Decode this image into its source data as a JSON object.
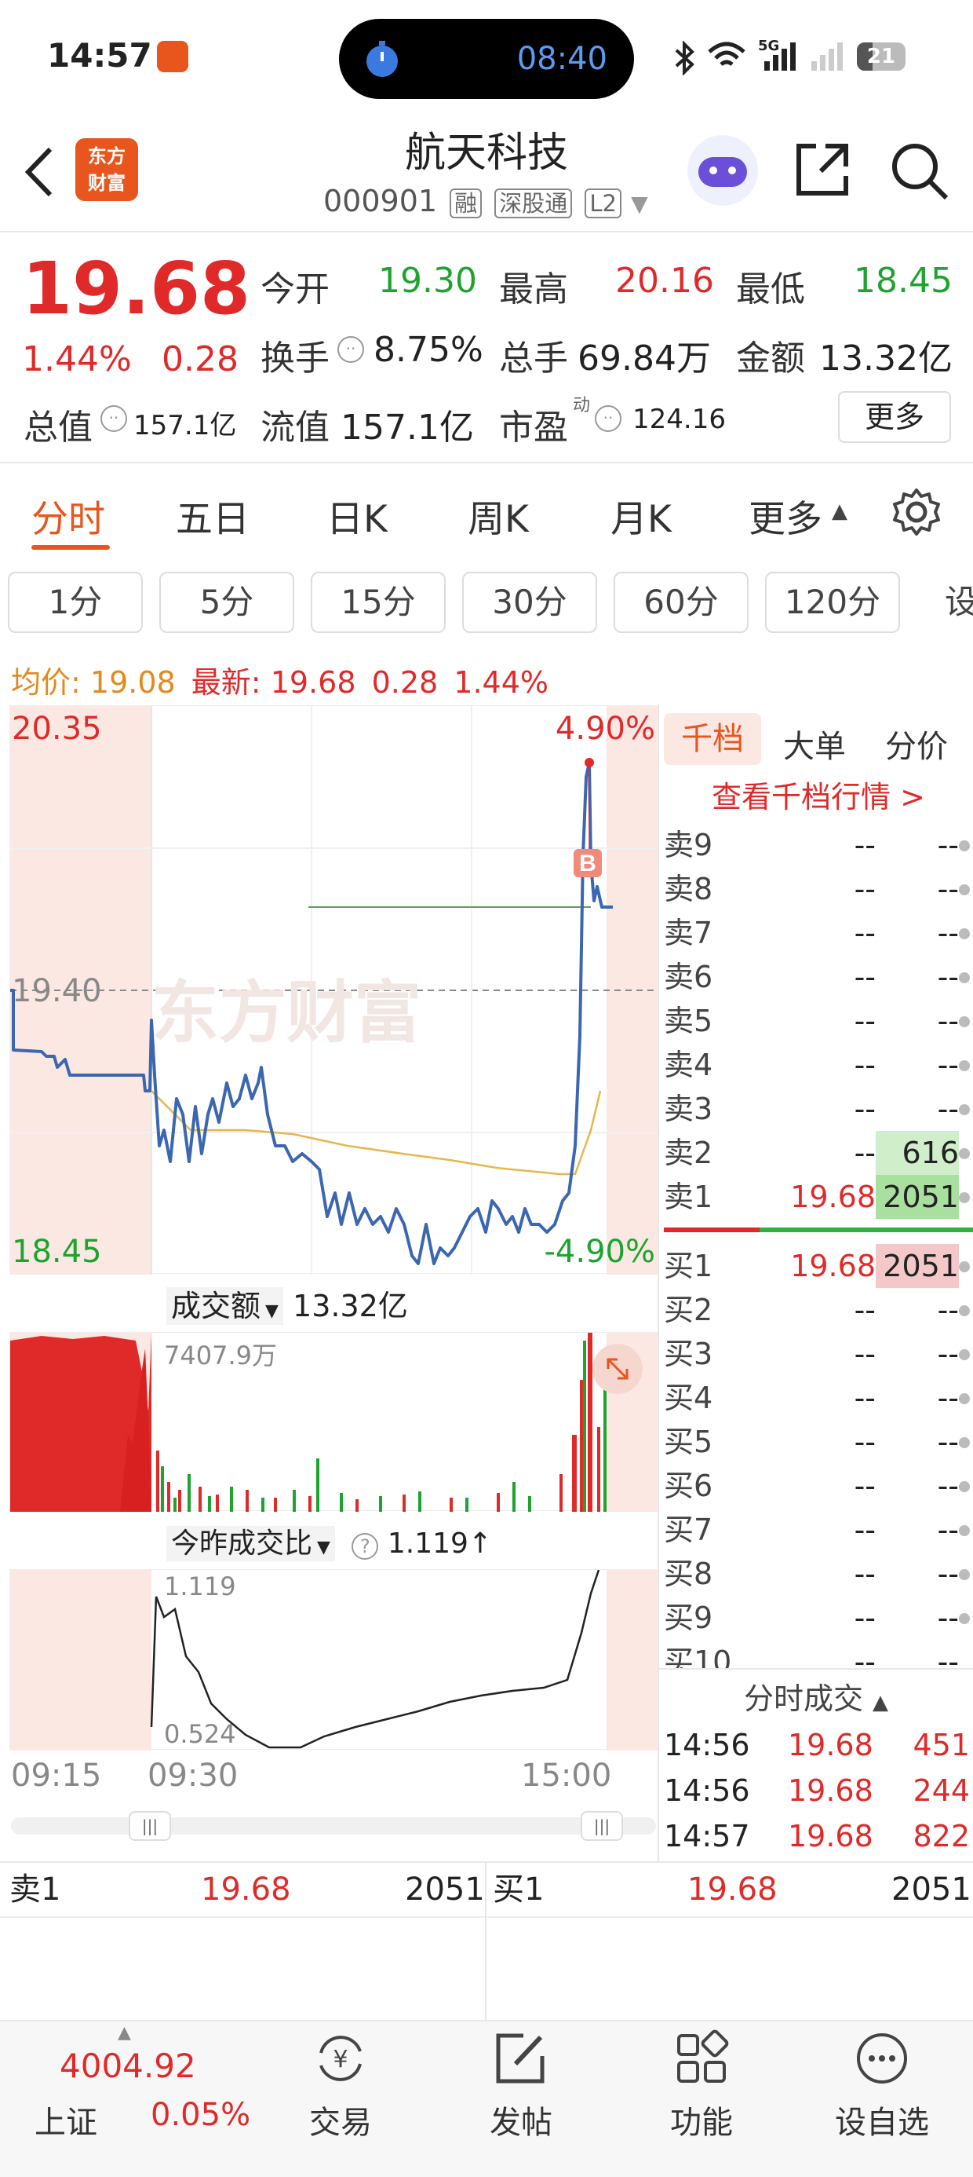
{
  "status_bar": {
    "time": "14:57",
    "timer": "08:40",
    "battery": "21",
    "network": "5G"
  },
  "header": {
    "logo_text_1": "东方",
    "logo_text_2": "财富",
    "stock_name": "航天科技",
    "stock_code": "000901",
    "tags": [
      "融",
      "深股通",
      "L2"
    ]
  },
  "quote": {
    "price": "19.68",
    "change_pct": "1.44%",
    "change": "0.28",
    "fields": {
      "open_label": "今开",
      "open": "19.30",
      "high_label": "最高",
      "high": "20.16",
      "low_label": "最低",
      "low": "18.45",
      "turnover_label": "换手",
      "turnover": "8.75%",
      "volume_label": "总手",
      "volume": "69.84万",
      "amount_label": "金额",
      "amount": "13.32亿",
      "mktcap_label": "总值",
      "mktcap": "157.1亿",
      "float_label": "流值",
      "float": "157.1亿",
      "pe_label": "市盈",
      "pe_sup": "动",
      "pe": "124.16"
    },
    "more_button": "更多"
  },
  "chart_tabs": [
    "分时",
    "五日",
    "日K",
    "周K",
    "月K",
    "更多"
  ],
  "interval_tabs": [
    "1分",
    "5分",
    "15分",
    "30分",
    "60分",
    "120分",
    "设"
  ],
  "info_line": {
    "avg_label": "均价:",
    "avg": "19.08",
    "latest_label": "最新:",
    "latest": "19.68",
    "change": "0.28",
    "change_pct": "1.44%"
  },
  "price_chart": {
    "y_top": "20.35",
    "y_mid": "19.40",
    "y_bottom": "18.45",
    "pct_top": "4.90%",
    "pct_bottom": "-4.90%",
    "watermark": "东方财富",
    "marker": "B"
  },
  "volume_panel": {
    "label": "成交额",
    "total": "13.32亿",
    "max_label": "7407.9万"
  },
  "ratio_panel": {
    "label": "今昨成交比",
    "value": "1.119",
    "arrow": "↑",
    "max_label": "1.119",
    "min_label": "0.524"
  },
  "time_axis": [
    "09:15",
    "09:30",
    "15:00"
  ],
  "order_book": {
    "tabs": [
      "千档",
      "大单",
      "分价"
    ],
    "link": "查看千档行情 >",
    "asks": [
      {
        "label": "卖9",
        "price": "--",
        "vol": "--"
      },
      {
        "label": "卖8",
        "price": "--",
        "vol": "--"
      },
      {
        "label": "卖7",
        "price": "--",
        "vol": "--"
      },
      {
        "label": "卖6",
        "price": "--",
        "vol": "--"
      },
      {
        "label": "卖5",
        "price": "--",
        "vol": "--"
      },
      {
        "label": "卖4",
        "price": "--",
        "vol": "--"
      },
      {
        "label": "卖3",
        "price": "--",
        "vol": "--"
      },
      {
        "label": "卖2",
        "price": "--",
        "vol": "616"
      },
      {
        "label": "卖1",
        "price": "19.68",
        "vol": "2051"
      }
    ],
    "bids": [
      {
        "label": "买1",
        "price": "19.68",
        "vol": "2051"
      },
      {
        "label": "买2",
        "price": "--",
        "vol": "--"
      },
      {
        "label": "买3",
        "price": "--",
        "vol": "--"
      },
      {
        "label": "买4",
        "price": "--",
        "vol": "--"
      },
      {
        "label": "买5",
        "price": "--",
        "vol": "--"
      },
      {
        "label": "买6",
        "price": "--",
        "vol": "--"
      },
      {
        "label": "买7",
        "price": "--",
        "vol": "--"
      },
      {
        "label": "买8",
        "price": "--",
        "vol": "--"
      },
      {
        "label": "买9",
        "price": "--",
        "vol": "--"
      },
      {
        "label": "买10",
        "price": "--",
        "vol": "--"
      }
    ],
    "ticks_title": "分时成交",
    "ticks": [
      {
        "time": "14:56",
        "price": "19.68",
        "vol": "451"
      },
      {
        "time": "14:56",
        "price": "19.68",
        "vol": "244"
      },
      {
        "time": "14:57",
        "price": "19.68",
        "vol": "822"
      }
    ]
  },
  "bottom_quote": {
    "ask_label": "卖1",
    "ask_price": "19.68",
    "ask_vol": "2051",
    "bid_label": "买1",
    "bid_price": "19.68",
    "bid_vol": "2051"
  },
  "bottom_nav": {
    "index_value": "4004.92",
    "index_name": "上证",
    "index_change": "0.05%",
    "items": [
      "交易",
      "发帖",
      "功能",
      "设自选"
    ]
  },
  "colors": {
    "up": "#e02a2a",
    "down": "#1fa32f",
    "line": "#3b66b0",
    "avg": "#e8b64c",
    "accent": "#e8561e"
  }
}
